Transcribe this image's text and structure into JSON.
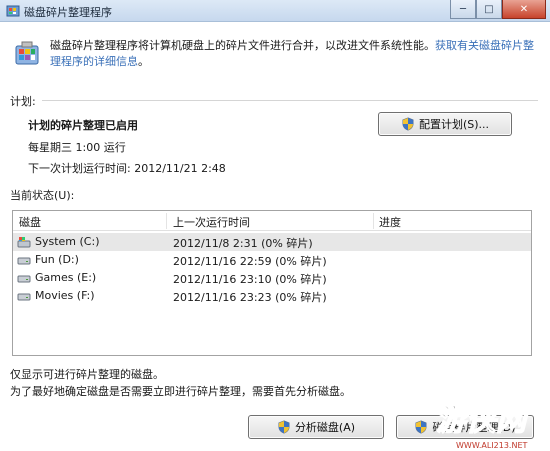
{
  "window": {
    "title": "磁盘碎片整理程序",
    "controls": [
      "minimize",
      "maximize",
      "close"
    ]
  },
  "header": {
    "description": "磁盘碎片整理程序将计算机硬盘上的碎片文件进行合并，以改进文件系统性能。",
    "link": "获取有关磁盘碎片整理程序的详细信息",
    "link_suffix": "。"
  },
  "schedule": {
    "section_label": "计划:",
    "status": "计划的碎片整理已启用",
    "frequency": "每星期三  1:00 运行",
    "next_run": "下一次计划运行时间: 2012/11/21 2:48",
    "configure_button": "配置计划(S)..."
  },
  "current_status": {
    "section_label": "当前状态(U):",
    "columns": [
      "磁盘",
      "上一次运行时间",
      "进度"
    ],
    "rows": [
      {
        "disk": "System (C:)",
        "last_run": "2012/11/8 2:31 (0% 碎片)",
        "progress": "",
        "icon": "system-drive-icon",
        "selected": true
      },
      {
        "disk": "Fun (D:)",
        "last_run": "2012/11/16 22:59 (0% 碎片)",
        "progress": "",
        "icon": "drive-icon",
        "selected": false
      },
      {
        "disk": "Games (E:)",
        "last_run": "2012/11/16 23:10 (0% 碎片)",
        "progress": "",
        "icon": "drive-icon",
        "selected": false
      },
      {
        "disk": "Movies (F:)",
        "last_run": "2012/11/16 23:23 (0% 碎片)",
        "progress": "",
        "icon": "drive-icon",
        "selected": false
      }
    ]
  },
  "footer": {
    "note1": "仅显示可进行碎片整理的磁盘。",
    "note2": "为了最好地确定磁盘是否需要立即进行碎片整理，需要首先分析磁盘。",
    "analyze_button": "分析磁盘(A)",
    "defrag_button": "磁盘碎片整理(D)"
  },
  "watermark": {
    "logo_text": "游侠网",
    "url": "WWW.ALI213.NET"
  },
  "colors": {
    "link": "#3a70b8",
    "titlebar": "#c6d8ee",
    "selected_row": "#e7e7e7"
  }
}
